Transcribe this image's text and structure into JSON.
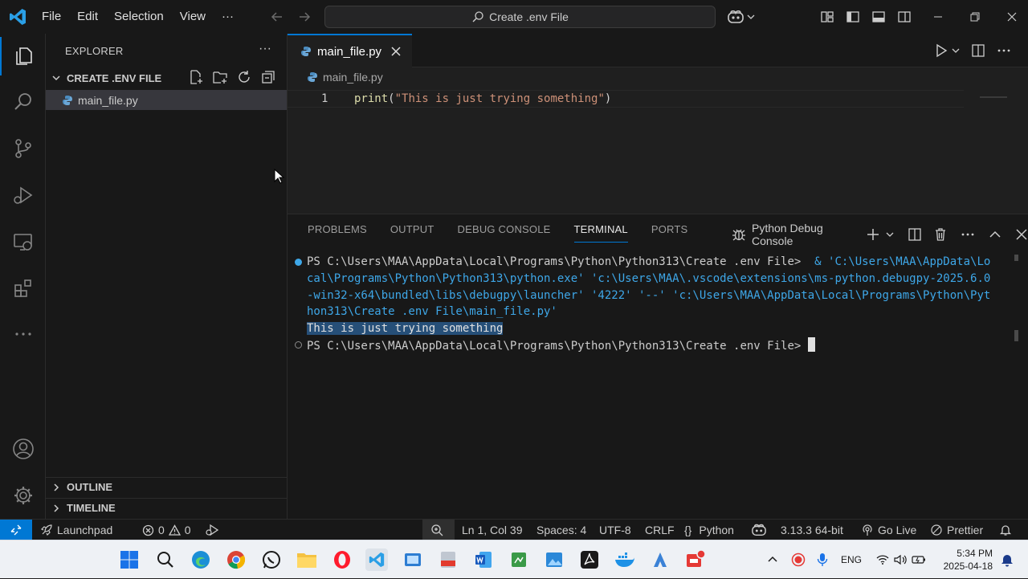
{
  "titlebar": {
    "menus": [
      "File",
      "Edit",
      "Selection",
      "View"
    ],
    "more": "···",
    "search_text": "Create .env File"
  },
  "explorer": {
    "title": "EXPLORER",
    "more": "···",
    "folder_name": "CREATE .ENV FILE",
    "files": [
      "main_file.py"
    ],
    "sections": [
      "OUTLINE",
      "TIMELINE"
    ]
  },
  "editor": {
    "tab_label": "main_file.py",
    "breadcrumb": "main_file.py",
    "line_number": "1",
    "code": {
      "fn": "print",
      "open": "(",
      "str": "\"This is just trying something\"",
      "close": ")"
    }
  },
  "panel": {
    "tabs": [
      "PROBLEMS",
      "OUTPUT",
      "DEBUG CONSOLE",
      "TERMINAL",
      "PORTS"
    ],
    "active_tab": "TERMINAL",
    "terminal_name": "Python Debug Console",
    "lines": {
      "prompt1": "PS C:\\Users\\MAA\\AppData\\Local\\Programs\\Python\\Python313\\Create .env File> ",
      "cmd1a": " & 'C:\\Users\\MAA\\AppData\\Lo",
      "cmd2": "cal\\Programs\\Python\\Python313\\python.exe' 'c:\\Users\\MAA\\.vscode\\extensions\\ms-python.debugpy-2025.6.0",
      "cmd3": "-win32-x64\\bundled\\libs\\debugpy\\launcher' '4222' '--' 'c:\\Users\\MAA\\AppData\\Local\\Programs\\Python\\Pyt",
      "cmd4": "hon313\\Create .env File\\main_file.py'",
      "output": "This is just trying something",
      "prompt2": "PS C:\\Users\\MAA\\AppData\\Local\\Programs\\Python\\Python313\\Create .env File> "
    }
  },
  "statusbar": {
    "launchpad": "Launchpad",
    "errors": "0",
    "warnings": "0",
    "position": "Ln 1, Col 39",
    "spaces": "Spaces: 4",
    "encoding": "UTF-8",
    "eol": "CRLF",
    "language_braces": "{}",
    "language": "Python",
    "interpreter": "3.13.3 64-bit",
    "golive": "Go Live",
    "prettier": "Prettier"
  },
  "taskbar": {
    "lang": "ENG",
    "time": "5:34 PM",
    "date": "2025-04-18"
  },
  "colors": {
    "accent": "#0078d4",
    "string": "#ce9178",
    "function": "#dcdcaa",
    "terminal_cmd": "#3ea7e8"
  }
}
